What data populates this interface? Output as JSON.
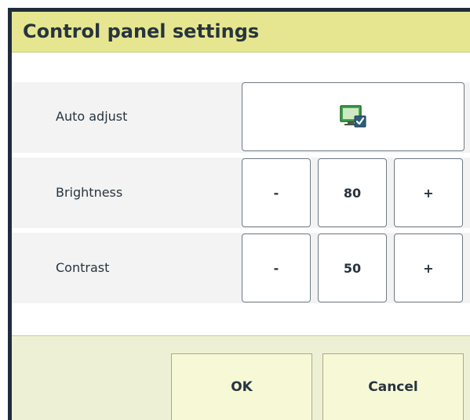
{
  "dialog": {
    "title": "Control panel settings"
  },
  "settings": {
    "auto_adjust": {
      "label": "Auto adjust",
      "icon": "monitor-check-icon",
      "enabled": true
    },
    "brightness": {
      "label": "Brightness",
      "decrease_label": "-",
      "value": "80",
      "increase_label": "+"
    },
    "contrast": {
      "label": "Contrast",
      "decrease_label": "-",
      "value": "50",
      "increase_label": "+"
    }
  },
  "footer": {
    "ok_label": "OK",
    "cancel_label": "Cancel"
  },
  "colors": {
    "title_bar": "#e6e690",
    "footer": "#eef0d6",
    "frame": "#1f2c3e",
    "icon_green": "#2e8b3a"
  }
}
